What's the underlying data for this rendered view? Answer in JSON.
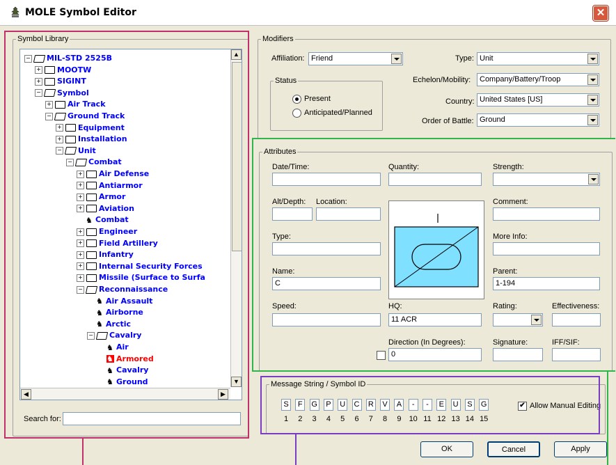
{
  "window": {
    "title": "MOLE Symbol Editor",
    "close_glyph": "✕"
  },
  "library": {
    "legend": "Symbol Library",
    "search_label": "Search for:",
    "search_value": "",
    "tree": [
      {
        "label": "MIL-STD 2525B"
      },
      {
        "label": "MOOTW"
      },
      {
        "label": "SIGINT"
      },
      {
        "label": "Symbol"
      },
      {
        "label": "Air Track"
      },
      {
        "label": "Ground Track"
      },
      {
        "label": "Equipment"
      },
      {
        "label": "Installation"
      },
      {
        "label": "Unit"
      },
      {
        "label": "Combat"
      },
      {
        "label": "Air Defense"
      },
      {
        "label": "Antiarmor"
      },
      {
        "label": "Armor"
      },
      {
        "label": "Aviation"
      },
      {
        "label": "Combat"
      },
      {
        "label": "Engineer"
      },
      {
        "label": "Field Artillery"
      },
      {
        "label": "Infantry"
      },
      {
        "label": "Internal Security Forces"
      },
      {
        "label": "Missile (Surface to Surfa"
      },
      {
        "label": "Reconnaissance"
      },
      {
        "label": "Air Assault"
      },
      {
        "label": "Airborne"
      },
      {
        "label": "Arctic"
      },
      {
        "label": "Cavalry"
      },
      {
        "label": "Air"
      },
      {
        "label": "Armored"
      },
      {
        "label": "Cavalry"
      },
      {
        "label": "Ground"
      }
    ]
  },
  "modifiers": {
    "legend": "Modifiers",
    "affiliation_label": "Affiliation:",
    "affiliation_value": "Friend",
    "type_label": "Type:",
    "type_value": "Unit",
    "echelon_label": "Echelon/Mobility:",
    "echelon_value": "Company/Battery/Troop",
    "country_label": "Country:",
    "country_value": "United States [US]",
    "order_label": "Order of Battle:",
    "order_value": "Ground",
    "status": {
      "legend": "Status",
      "present": "Present",
      "anticipated": "Anticipated/Planned",
      "selected": "Present"
    }
  },
  "attributes": {
    "legend": "Attributes",
    "datetime_label": "Date/Time:",
    "datetime_value": "",
    "quantity_label": "Quantity:",
    "quantity_value": "",
    "strength_label": "Strength:",
    "strength_value": "",
    "altdepth_label": "Alt/Depth:",
    "altdepth_value": "",
    "location_label": "Location:",
    "location_value": "",
    "comment_label": "Comment:",
    "comment_value": "",
    "type_label": "Type:",
    "type_value": "",
    "moreinfo_label": "More Info:",
    "moreinfo_value": "",
    "name_label": "Name:",
    "name_value": "C",
    "parent_label": "Parent:",
    "parent_value": "1-194",
    "speed_label": "Speed:",
    "speed_value": "",
    "hq_label": "HQ:",
    "hq_value": "11 ACR",
    "rating_label": "Rating:",
    "rating_value": "",
    "effectiveness_label": "Effectiveness:",
    "effectiveness_value": "",
    "direction_label": "Direction (In Degrees):",
    "direction_value": "0",
    "signature_label": "Signature:",
    "signature_value": "",
    "iff_label": "IFF/SIF:",
    "iff_value": "",
    "symbol_fill_color": "#80e0ff"
  },
  "message": {
    "legend": "Message String / Symbol ID",
    "chars": [
      "S",
      "F",
      "G",
      "P",
      "U",
      "C",
      "R",
      "V",
      "A",
      "-",
      "-",
      "E",
      "U",
      "S",
      "G"
    ],
    "positions": [
      "1",
      "2",
      "3",
      "4",
      "5",
      "6",
      "7",
      "8",
      "9",
      "10",
      "11",
      "12",
      "13",
      "14",
      "15"
    ],
    "allow_manual_label": "Allow Manual Editing",
    "allow_manual_checked": true
  },
  "buttons": {
    "ok": "OK",
    "cancel": "Cancel",
    "apply": "Apply"
  },
  "colors": {
    "tree_text": "#0000ff",
    "selected_item": "#ff0000",
    "overlay_pink": "#c0306a",
    "overlay_green": "#2fb54a",
    "overlay_purple": "#7a3cc0"
  }
}
